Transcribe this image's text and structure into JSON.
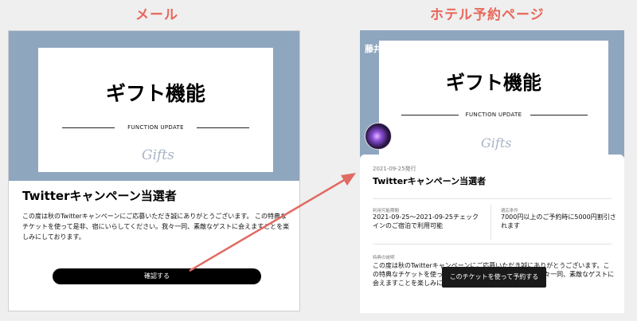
{
  "labels": {
    "mail": "メール",
    "hotel": "ホテル予約ページ"
  },
  "colors": {
    "label": "#e8675a",
    "hero": "#8fa6bf",
    "arrow": "#e06b62",
    "button": "#000000"
  },
  "mail": {
    "card": {
      "title": "ギフト機能",
      "subtitle": "FUNCTION UPDATE",
      "signature": "Gifts"
    },
    "title": "Twitterキャンペーン当選者",
    "body": "この度は秋のTwitterキャンペーンにご応募いただき誠にありがとうございます。 この特典なチケットを使って是非、宿にいらしてください。我々一同、素敵なゲストに会えますことを楽しみにしております。",
    "confirm_label": "確認する"
  },
  "hotel": {
    "name": "藤井",
    "card": {
      "title": "ギフト機能",
      "subtitle": "FUNCTION UPDATE",
      "signature": "Gifts"
    },
    "issue_date": "2021-09-25発行",
    "ticket_title": "Twitterキャンペーン当選者",
    "period_label": "利用可能期間",
    "period_value": "2021-09-25〜2021-09-25チェックインのご宿泊で利用可能",
    "condition_label": "適応条件",
    "condition_value": "7000円以上のご予約時に5000円割引されます",
    "desc_label": "特典の説明",
    "desc_body": "この度は秋のTwitterキャンペーンにご応募いただき誠にありがとうございます。この特典なチケットを使って是非、宿にいらしてください。我々一同、素敵なゲストに会えますことを楽しみにしております。",
    "reserve_label": "このチケットを使って予約する"
  }
}
